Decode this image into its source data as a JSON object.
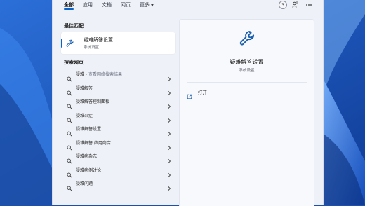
{
  "tabs": [
    {
      "label": "全部",
      "active": true
    },
    {
      "label": "应用",
      "active": false
    },
    {
      "label": "文档",
      "active": false
    },
    {
      "label": "网页",
      "active": false
    },
    {
      "label": "更多",
      "active": false,
      "dropdown": true
    }
  ],
  "header": {
    "badge_count": "3"
  },
  "best_match": {
    "section_title": "最佳匹配",
    "title": "疑难解答设置",
    "subtitle": "系统设置",
    "icon": "wrench-icon"
  },
  "web_search": {
    "section_title": "搜索网页",
    "items": [
      {
        "query": "疑难",
        "hint": " - 查看网络搜索结果"
      },
      {
        "query": "疑难解答",
        "hint": ""
      },
      {
        "query": "疑难解答控制面板",
        "hint": ""
      },
      {
        "query": "疑难杂症",
        "hint": ""
      },
      {
        "query": "疑难解答设置",
        "hint": ""
      },
      {
        "query": "疑难解答 应用商店",
        "hint": ""
      },
      {
        "query": "疑难病杂志",
        "hint": ""
      },
      {
        "query": "疑难病例讨论",
        "hint": ""
      },
      {
        "query": "疑难问题",
        "hint": ""
      }
    ]
  },
  "preview": {
    "title": "疑难解答设置",
    "subtitle": "系统设置",
    "icon": "wrench-icon",
    "actions": [
      {
        "label": "打开",
        "icon": "open-external-icon"
      }
    ]
  },
  "colors": {
    "accent": "#0a64c8",
    "panel_bg": "#eef1f7",
    "wallpaper": "#1c4fb0"
  }
}
